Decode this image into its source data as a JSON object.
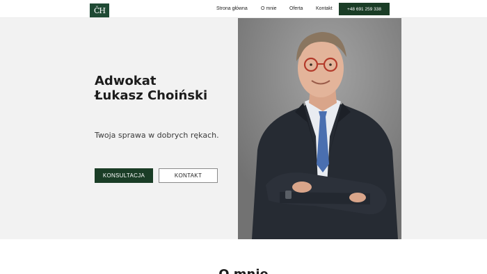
{
  "header": {
    "logo_text": "ČH",
    "nav": [
      {
        "label": "Strona główna"
      },
      {
        "label": "O mnie"
      },
      {
        "label": "Oferta"
      },
      {
        "label": "Kontakt"
      }
    ],
    "phone": "+48 691 259 338"
  },
  "hero": {
    "title_line1": "Adwokat",
    "title_line2": "Łukasz Choiński",
    "subtitle": "Twoja sprawa w dobrych rękach.",
    "btn_consult": "KONSULTACJA",
    "btn_contact": "KONTAKT",
    "photo_icon": "portrait-photo"
  },
  "about": {
    "title": "O mnie"
  },
  "colors": {
    "brand_green": "#1a3d26",
    "hero_bg": "#f2f2f2"
  }
}
